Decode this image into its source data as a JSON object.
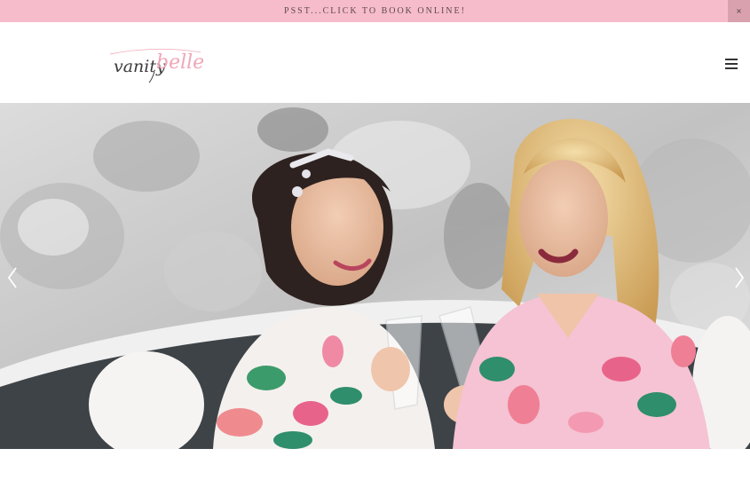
{
  "announcement": {
    "text": "PSST...CLICK TO BOOK ONLINE!",
    "close_label": "×"
  },
  "header": {
    "logo": {
      "primary": "vanity",
      "secondary": "belle"
    },
    "menu_icon": "hamburger-menu-icon"
  },
  "hero": {
    "image_subject": "bridal-party-photo",
    "prev_icon": "chevron-left-icon",
    "next_icon": "chevron-right-icon"
  },
  "colors": {
    "banner_bg": "#f7bccb",
    "close_bg": "#d9a1ae",
    "logo_dark": "#3b3b3b",
    "logo_pink": "#f0a7b8"
  }
}
